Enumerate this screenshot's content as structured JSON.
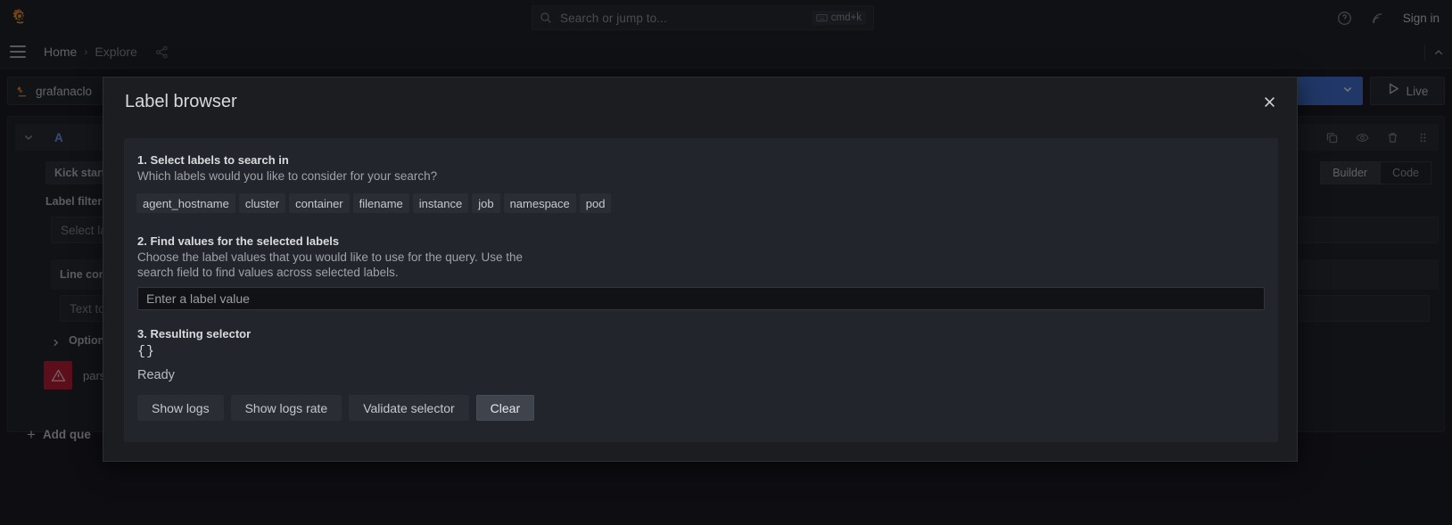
{
  "topnav": {
    "logo_icon": "grafana-logo-icon",
    "search": {
      "placeholder": "Search or jump to...",
      "icon": "search-icon",
      "shortcut": "cmd+k",
      "shortcut_icon": "keyboard-icon"
    },
    "help_icon": "help-circle-icon",
    "news_icon": "rss-news-icon",
    "signin_label": "Sign in"
  },
  "breadcrumb": {
    "menu_icon": "hamburger-menu-icon",
    "home": "Home",
    "separator": "›",
    "current": "Explore",
    "share_icon": "share-icon",
    "collapse_icon": "chevron-up-icon"
  },
  "explore": {
    "datasource": {
      "name": "grafanaclo",
      "icon": "loki-datasource-icon"
    },
    "run_query_dropdown_icon": "chevron-down-icon",
    "live_label": "Live",
    "live_icon": "play-icon",
    "query_row": {
      "ref_id": "A",
      "collapse_icon": "chevron-down-icon",
      "icons": [
        "copy-icon",
        "eye-icon",
        "trash-icon",
        "drag-handle-icon"
      ]
    },
    "kickstart_label": "Kick start y",
    "kickstart_suffix": "",
    "editor_tabs": [
      {
        "label": "Builder",
        "active": true
      },
      {
        "label": "Code",
        "active": false
      }
    ],
    "label_filters_title": "Label filters",
    "select_label_placeholder": "Select la",
    "line_contains_title": "Line con",
    "text_to_find_placeholder": "Text to",
    "options_label": "Options",
    "options_chevron_icon": "chevron-right-icon",
    "error_badge_icon": "warning-triangle-icon",
    "error_text": "parse",
    "add_query_label": "Add que",
    "add_query_icon": "plus-icon"
  },
  "modal": {
    "title": "Label browser",
    "close_icon": "close-icon",
    "step1": {
      "heading": "1. Select labels to search in",
      "description": "Which labels would you like to consider for your search?",
      "labels": [
        "agent_hostname",
        "cluster",
        "container",
        "filename",
        "instance",
        "job",
        "namespace",
        "pod"
      ]
    },
    "step2": {
      "heading": "2. Find values for the selected labels",
      "description": "Choose the label values that you would like to use for the query. Use the search field to find values across selected labels.",
      "input_value": "",
      "input_placeholder": "Enter a label value"
    },
    "step3": {
      "heading": "3. Resulting selector",
      "selector": "{}",
      "status": "Ready",
      "buttons": [
        {
          "label": "Show logs",
          "primary": false
        },
        {
          "label": "Show logs rate",
          "primary": false
        },
        {
          "label": "Validate selector",
          "primary": false
        },
        {
          "label": "Clear",
          "primary": true
        }
      ]
    }
  },
  "colors": {
    "page_bg": "#111217",
    "panel_bg": "#1b1d21",
    "modal_body_bg": "#22252b",
    "accent_blue": "#3d71d9",
    "ref_id_blue": "#6e9fff",
    "error_red": "#c4162a",
    "text_primary": "#d8d9da",
    "text_secondary": "#9fa2a8"
  }
}
